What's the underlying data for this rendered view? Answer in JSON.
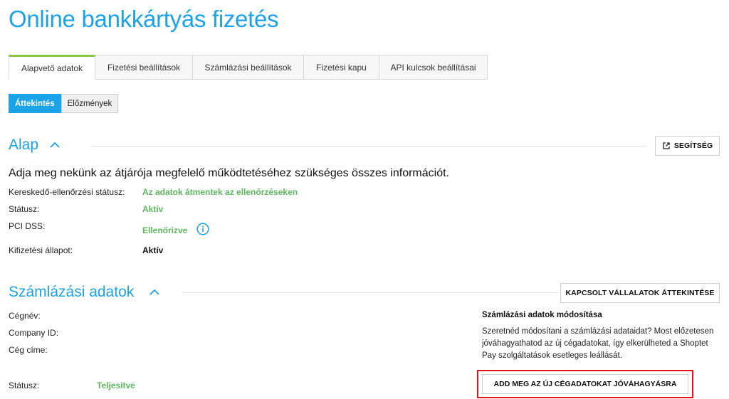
{
  "page": {
    "title": "Online bankkártyás fizetés"
  },
  "tabs": [
    {
      "label": "Alapvető adatok",
      "active": true
    },
    {
      "label": "Fizetési beállítások",
      "active": false
    },
    {
      "label": "Számlázási beállítások",
      "active": false
    },
    {
      "label": "Fizetési kapu",
      "active": false
    },
    {
      "label": "API kulcsok beállításai",
      "active": false
    }
  ],
  "subtabs": [
    {
      "label": "Áttekintés",
      "active": true
    },
    {
      "label": "Előzmények",
      "active": false
    }
  ],
  "basic": {
    "title": "Alap",
    "help_label": "SEGÍTSÉG",
    "intro": "Adja meg nekünk az átjárója megfelelő működtetéséhez szükséges összes információt.",
    "rows": [
      {
        "label": "Kereskedő-ellenőrzési státusz:",
        "value": "Az adatok átmentek az ellenőrzéseken"
      },
      {
        "label": "Státusz:",
        "value": "Aktív"
      },
      {
        "label": "PCI DSS:",
        "value": "Ellenőrizve"
      },
      {
        "label": "Kifizetési állapot:",
        "value": "Aktív"
      }
    ]
  },
  "billing": {
    "title": "Számlázási adatok",
    "related_label": "KAPCSOLT VÁLLALATOK ÁTTEKINTÉSE",
    "fields": [
      {
        "label": "Cégnév:"
      },
      {
        "label": "Company ID:"
      },
      {
        "label": "Cég címe:"
      }
    ],
    "status_label": "Státusz:",
    "status_value": "Teljesítve",
    "panel": {
      "title": "Számlázási adatok módosítása",
      "text": "Szeretnéd módosítani a számlázási adataidat? Most előzetesen jóváhagyathatod az új cégadatokat, így elkerülheted a Shoptet Pay szolgáltatások esetleges leállását.",
      "button_label": "ADD MEG AZ ÚJ CÉGADATOKAT JÓVÁHAGYÁSRA"
    }
  },
  "colors": {
    "accent": "#1aa3e8",
    "success": "#5cb85c",
    "active_tab_top": "#8cc63f",
    "highlight": "#e0151b"
  },
  "icons": {
    "collapse": "chevron-up-icon",
    "help": "external-link-icon",
    "info": "info-circle-icon"
  }
}
